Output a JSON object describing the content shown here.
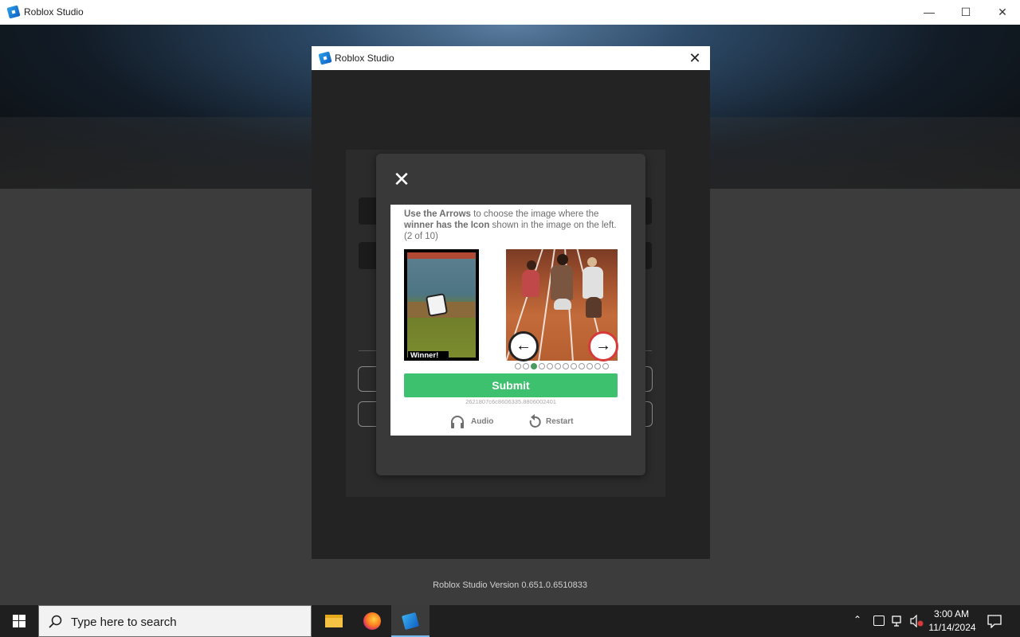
{
  "window": {
    "title": "Roblox Studio",
    "minimize_glyph": "—",
    "maximize_glyph": "☐",
    "close_glyph": "✕"
  },
  "inner_dialog": {
    "title": "Roblox Studio",
    "close_glyph": "✕"
  },
  "captcha": {
    "instruction_bold_1": "Use the Arrows",
    "instruction_text_1": " to choose the image where the ",
    "instruction_bold_2": "winner has the Icon",
    "instruction_text_2": " shown in the image on the left. (2 of 10)",
    "winner_label": "Winner!",
    "left_arrow": "←",
    "right_arrow": "→",
    "dots_total": 12,
    "dots_active_index": 2,
    "submit_label": "Submit",
    "session_id": "2621807c6c8606335.8806002401",
    "audio_label": "Audio",
    "restart_label": "Restart",
    "submit_color": "#3ec16e"
  },
  "footer": {
    "version": "Roblox Studio Version 0.651.0.6510833"
  },
  "taskbar": {
    "search_placeholder": "Type here to search",
    "apps": [
      "file-explorer",
      "firefox",
      "roblox-studio"
    ],
    "time": "3:00 AM",
    "date": "11/14/2024"
  }
}
